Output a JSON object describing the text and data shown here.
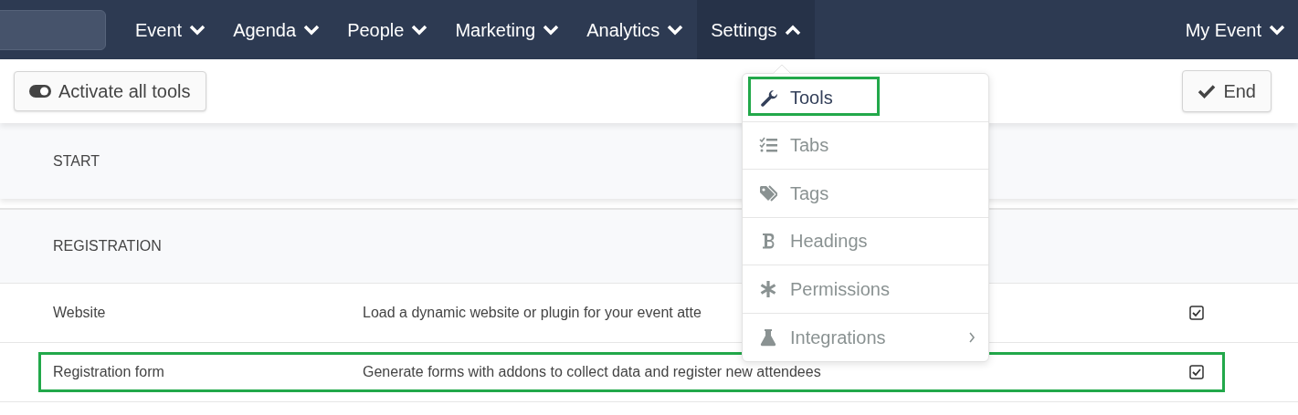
{
  "navbar": {
    "items": [
      {
        "label": "Event",
        "expanded": false
      },
      {
        "label": "Agenda",
        "expanded": false
      },
      {
        "label": "People",
        "expanded": false
      },
      {
        "label": "Marketing",
        "expanded": false
      },
      {
        "label": "Analytics",
        "expanded": false
      },
      {
        "label": "Settings",
        "expanded": true
      }
    ],
    "account": {
      "label": "My Event",
      "expanded": false
    }
  },
  "toolbar": {
    "activate_button": "Activate all tools",
    "end_button": "End"
  },
  "sections": [
    {
      "title": "START"
    },
    {
      "title": "REGISTRATION"
    }
  ],
  "rows": [
    {
      "name": "Website",
      "description": "Load a dynamic website or plugin for your event atte",
      "checked": true,
      "highlighted": false
    },
    {
      "name": "Registration form",
      "description": "Generate forms with addons to collect data and register new attendees",
      "checked": true,
      "highlighted": true
    }
  ],
  "settings_menu": [
    {
      "label": "Tools",
      "kind": "wrench",
      "selected": true,
      "highlighted": true,
      "has_submenu": false
    },
    {
      "label": "Tabs",
      "kind": "checklist",
      "selected": false,
      "highlighted": false,
      "has_submenu": false
    },
    {
      "label": "Tags",
      "kind": "tags",
      "selected": false,
      "highlighted": false,
      "has_submenu": false
    },
    {
      "label": "Headings",
      "kind": "bold",
      "selected": false,
      "highlighted": false,
      "has_submenu": false
    },
    {
      "label": "Permissions",
      "kind": "asterisk",
      "selected": false,
      "highlighted": false,
      "has_submenu": false
    },
    {
      "label": "Integrations",
      "kind": "flask",
      "selected": false,
      "highlighted": false,
      "has_submenu": true
    }
  ]
}
